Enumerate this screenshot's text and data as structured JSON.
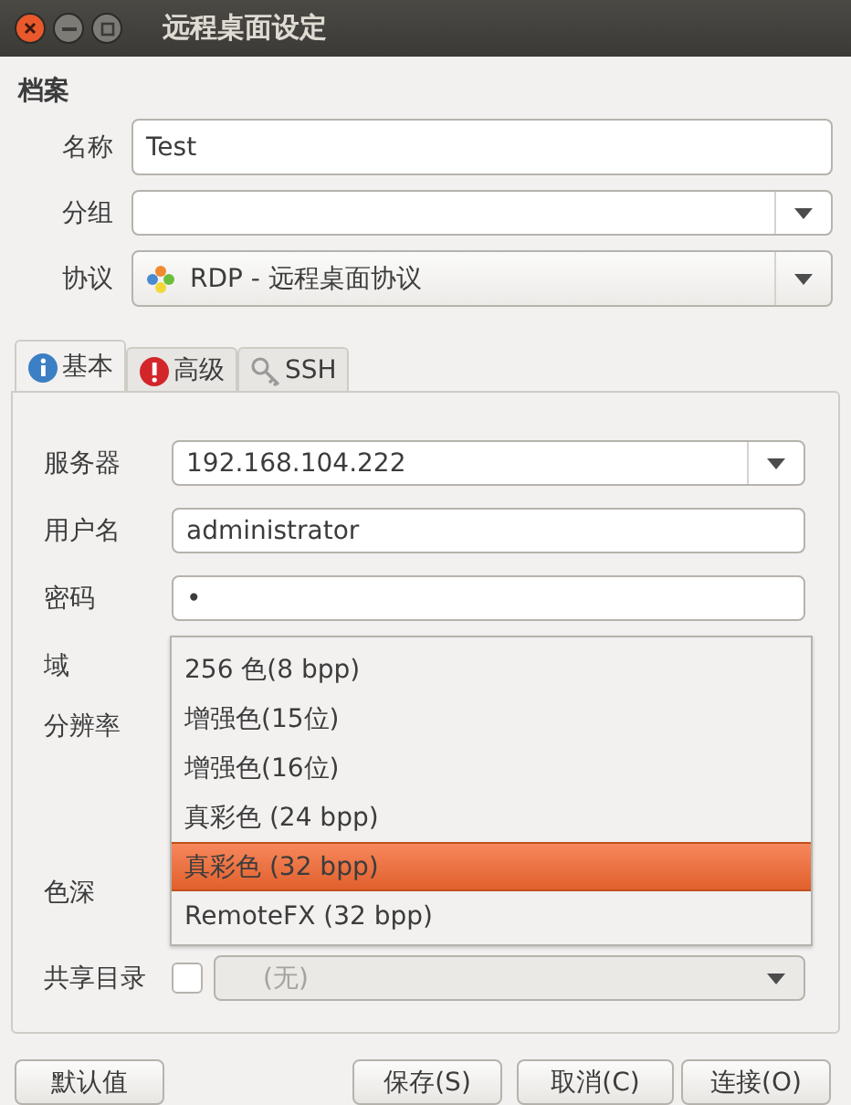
{
  "window": {
    "title": "远程桌面设定"
  },
  "profile": {
    "heading": "档案",
    "fields": [
      {
        "label": "名称",
        "kind": "text",
        "value": "Test"
      },
      {
        "label": "分组",
        "kind": "combo"
      },
      {
        "label": "协议",
        "kind": "protocol",
        "value": "RDP - 远程桌面协议"
      }
    ]
  },
  "tabs": [
    {
      "label": "基本",
      "selected": true
    },
    {
      "label": "高级",
      "selected": false
    },
    {
      "label": "SSH",
      "selected": false
    }
  ],
  "basic": {
    "fields": [
      {
        "label": "服务器",
        "kind": "combo",
        "value": "192.168.104.222"
      },
      {
        "label": "用户名",
        "kind": "text",
        "value": "administrator"
      },
      {
        "label": "密码",
        "kind": "text",
        "value": "•"
      },
      {
        "label": "域",
        "kind": "covered"
      },
      {
        "label": "分辨率",
        "kind": "covered-tall"
      },
      {
        "label": "色深",
        "kind": "covered"
      },
      {
        "label": "共享目录",
        "kind": "folder",
        "checked": false,
        "disabled": true,
        "value": "(无)"
      }
    ]
  },
  "color_depth_menu": [
    {
      "label": "256 色(8 bpp)",
      "selected": false
    },
    {
      "label": "增强色(15位)",
      "selected": false
    },
    {
      "label": "增强色(16位)",
      "selected": false
    },
    {
      "label": "真彩色 (24 bpp)",
      "selected": false
    },
    {
      "label": "真彩色 (32 bpp)",
      "selected": true
    },
    {
      "label": "RemoteFX (32 bpp)",
      "selected": false
    }
  ],
  "buttons": [
    "默认值",
    "保存(S)",
    "取消(C)",
    "连接(O)"
  ]
}
